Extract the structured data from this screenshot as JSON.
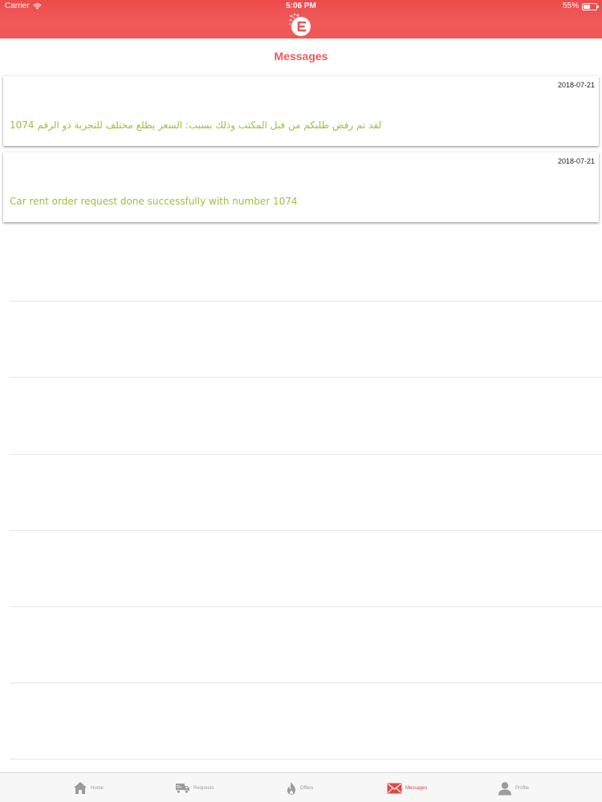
{
  "status_bar": {
    "carrier": "Carrier",
    "time": "5:06 PM",
    "battery": "55%",
    "battery_level": 0.55
  },
  "header": {
    "logo_icon": "app-logo-icon",
    "page_title": "Messages"
  },
  "messages": [
    {
      "date": "2018-07-21",
      "text": "لقد تم رفض طلبكم من قبل المكتب وذلك بسبب: السعر يطلع مختلف للتجربة ذو الرقم  1074"
    },
    {
      "date": "2018-07-21",
      "text": "Car rent order request done successfully with number 1074"
    }
  ],
  "tab_bar": {
    "items": [
      {
        "label": "Home",
        "icon": "home-icon",
        "active": false
      },
      {
        "label": "Requests",
        "icon": "truck-icon",
        "active": false
      },
      {
        "label": "Offers",
        "icon": "flame-icon",
        "active": false
      },
      {
        "label": "Messages",
        "icon": "envelope-icon",
        "active": true
      },
      {
        "label": "Profile",
        "icon": "person-icon",
        "active": false
      }
    ]
  },
  "colors": {
    "header": "#ef5252",
    "title": "#ec5a5a",
    "message_text": "#9ac13a",
    "tab_active": "#e24646",
    "tab_inactive": "#9b9b9b"
  }
}
